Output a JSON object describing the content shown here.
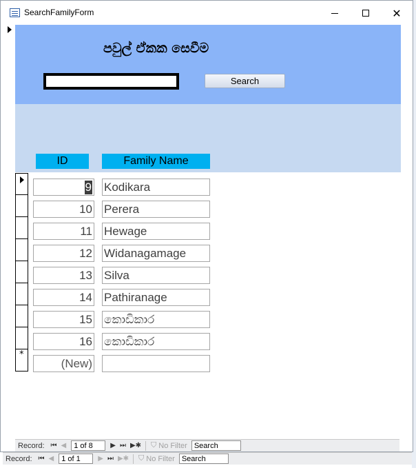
{
  "window": {
    "title": "SearchFamilyForm",
    "close_glyph": "✕"
  },
  "header": {
    "title": "පවුල් ඒකක සෙවීම",
    "search_value": "",
    "search_button_label": "Search"
  },
  "columns": {
    "id": "ID",
    "family_name": "Family Name"
  },
  "rows": [
    {
      "id": "9",
      "name": "Kodikara"
    },
    {
      "id": "10",
      "name": "Perera"
    },
    {
      "id": "11",
      "name": "Hewage"
    },
    {
      "id": "12",
      "name": "Widanagamage"
    },
    {
      "id": "13",
      "name": "Silva"
    },
    {
      "id": "14",
      "name": "Pathiranage"
    },
    {
      "id": "15",
      "name": "කොඩිකාර"
    },
    {
      "id": "16",
      "name": "කොඩිකාර"
    }
  ],
  "new_row": {
    "id": "(New)",
    "selector": "*"
  },
  "subform_nav": {
    "label": "Record:",
    "position": "1 of 8",
    "filter": "No Filter",
    "search": "Search"
  },
  "form_nav": {
    "label": "Record:",
    "position": "1 of 1",
    "filter": "No Filter",
    "search": "Search"
  },
  "icons": {
    "first": "⏮",
    "prev": "◀",
    "next": "▶",
    "last": "⏭",
    "new": "▶✱",
    "filter": "⛉"
  }
}
